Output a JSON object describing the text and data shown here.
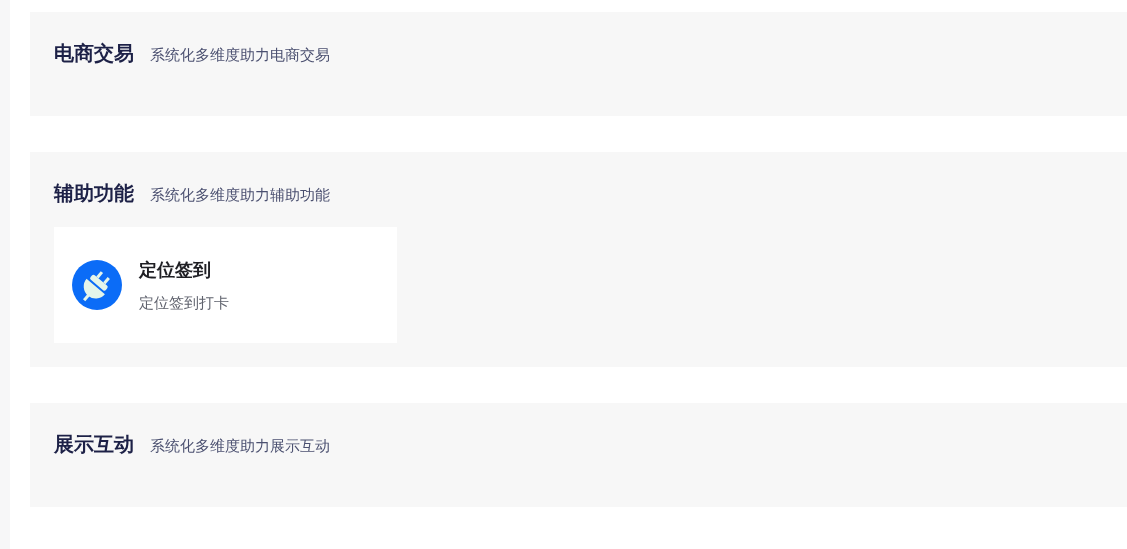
{
  "sections": [
    {
      "title": "电商交易",
      "subtitle": "系统化多维度助力电商交易"
    },
    {
      "title": "辅助功能",
      "subtitle": "系统化多维度助力辅助功能",
      "cards": [
        {
          "title": "定位签到",
          "description": "定位签到打卡"
        }
      ]
    },
    {
      "title": "展示互动",
      "subtitle": "系统化多维度助力展示互动"
    }
  ]
}
